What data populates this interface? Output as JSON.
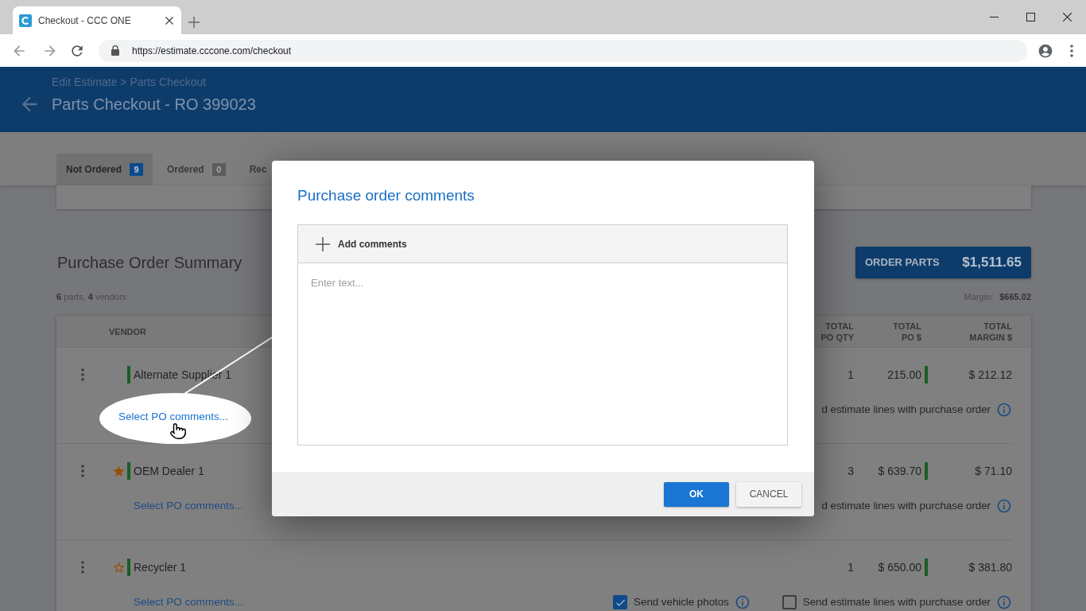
{
  "browser": {
    "tab_title": "Checkout - CCC ONE",
    "url": "https://estimate.cccone.com/checkout"
  },
  "header": {
    "breadcrumb": "Edit Estimate > Parts Checkout",
    "title": "Parts Checkout - RO 399023"
  },
  "tabs": [
    {
      "label": "Not Ordered",
      "count": "9",
      "selected": true
    },
    {
      "label": "Ordered",
      "count": "0",
      "selected": false
    },
    {
      "label": "Rec",
      "selected": false
    }
  ],
  "summary": {
    "title": "Purchase Order Summary",
    "counts": "**6** parts, **4** vendors",
    "order_button": {
      "label": "ORDER PARTS",
      "amount": "$1,511.65"
    },
    "margin": {
      "label": "Margin:",
      "value": "$665.02"
    }
  },
  "table": {
    "columns": [
      "VENDOR",
      "TOTAL PO QTY",
      "TOTAL PO $",
      "TOTAL MARGIN $"
    ],
    "rows": [
      {
        "vendor": "Alternate Supplier 1",
        "qty": "1",
        "po_total": "215.00",
        "margin": "$ 212.12",
        "options": [
          {
            "label": "d estimate lines with purchase order"
          }
        ]
      },
      {
        "starred": true,
        "vendor": "OEM Dealer 1",
        "qty": "3",
        "po_total": "$ 639.70",
        "margin": "$ 71.10",
        "comments_link": "Select PO comments...",
        "options": [
          {
            "label": "d estimate lines with purchase order"
          }
        ]
      },
      {
        "starred": false,
        "vendor": "Recycler 1",
        "qty": "1",
        "po_total": "$ 650.00",
        "margin": "$ 381.80",
        "comments_link": "Select PO comments...",
        "options": [
          {
            "label": "Send vehicle photos",
            "checked": true
          },
          {
            "label": "Send estimate lines with purchase order",
            "checked": false
          }
        ]
      }
    ]
  },
  "callout": {
    "link": "Select PO comments..."
  },
  "dialog": {
    "title": "Purchase order comments",
    "add_button": "Add comments",
    "placeholder": "Enter text...",
    "buttons": [
      {
        "label": "OK",
        "kind": "primary"
      },
      {
        "label": "CANCEL",
        "kind": "secondary"
      }
    ]
  }
}
